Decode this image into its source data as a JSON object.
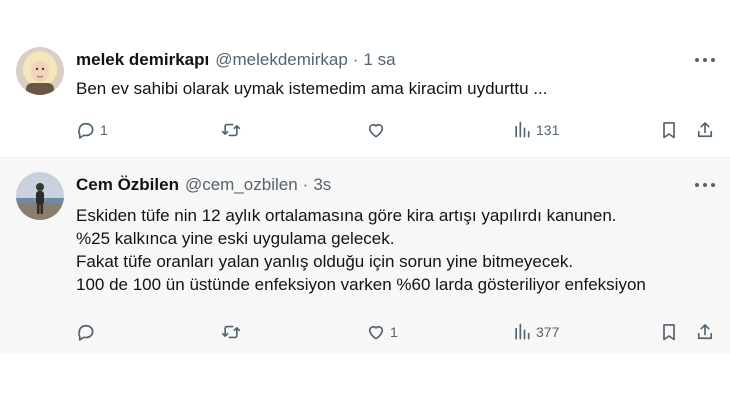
{
  "tweets": [
    {
      "name": "melek demirkapı",
      "handle": "@melekdemirkap",
      "separator": "·",
      "time": "1 sa",
      "lines": [
        "Ben ev sahibi olarak uymak istemedim ama kiracim uydurttu ..."
      ],
      "replies": "1",
      "retweets": "",
      "likes": "",
      "views": "131"
    },
    {
      "name": "Cem Özbilen",
      "handle": "@cem_ozbilen",
      "separator": "·",
      "time": "3s",
      "lines": [
        "Eskiden tüfe nin 12 aylık ortalamasına göre kira artışı yapılırdı kanunen.",
        "%25 kalkınca yine eski uygulama gelecek.",
        "Fakat tüfe oranları yalan yanlış olduğu için sorun yine bitmeyecek.",
        "100 de 100 ün üstünde enfeksiyon varken %60 larda gösteriliyor enfeksiyon"
      ],
      "replies": "",
      "retweets": "",
      "likes": "1",
      "views": "377"
    }
  ],
  "icons": {
    "reply": "reply-icon",
    "retweet": "retweet-icon",
    "like": "heart-icon",
    "views": "views-chart-icon",
    "bookmark": "bookmark-icon",
    "share": "share-icon",
    "more": "more-dots-icon"
  },
  "colors": {
    "text": "#0f1419",
    "secondary": "#536471",
    "highlight_background": "#f7f7f7"
  }
}
